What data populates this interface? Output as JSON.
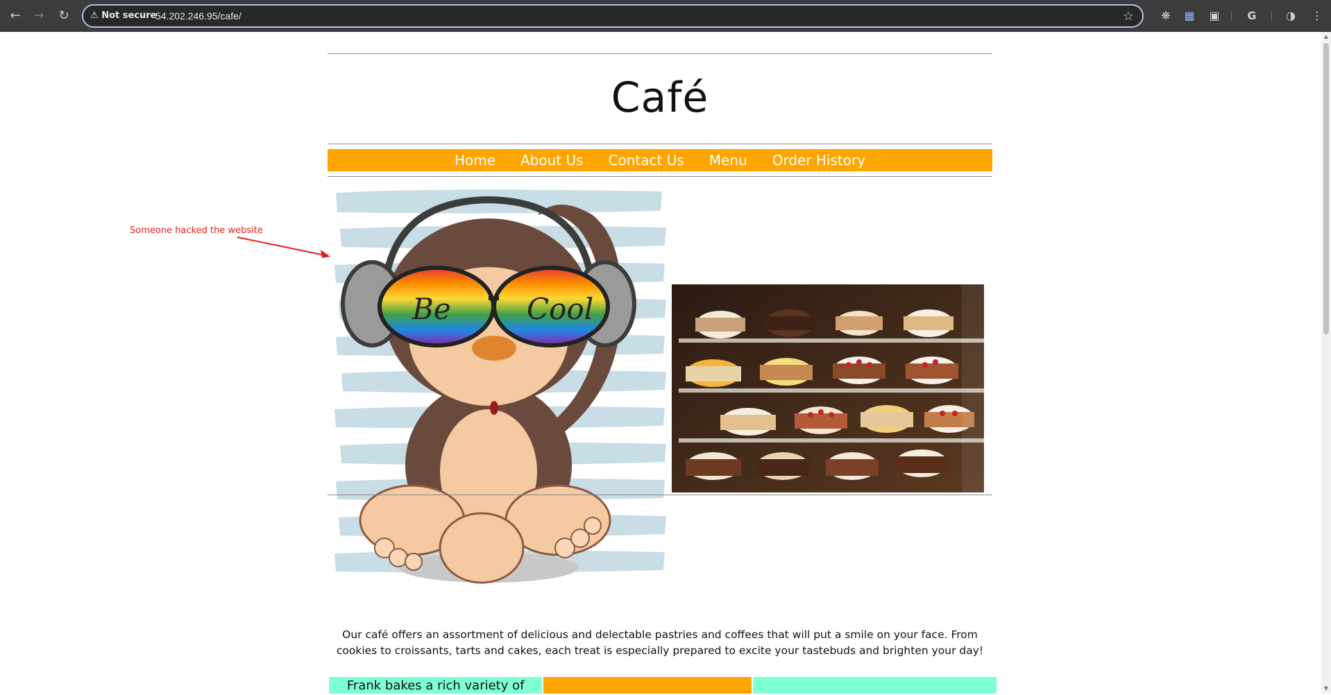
{
  "browser": {
    "security_label": "Not secure",
    "url": "54.202.246.95/cafe/",
    "back_icon": "arrow-left-icon",
    "forward_icon": "arrow-right-icon",
    "reload_icon": "reload-icon",
    "bookmark_icon": "star-icon"
  },
  "site": {
    "title": "Café"
  },
  "nav": {
    "items": [
      {
        "label": "Home"
      },
      {
        "label": "About Us"
      },
      {
        "label": "Contact Us"
      },
      {
        "label": "Menu"
      },
      {
        "label": "Order History"
      }
    ]
  },
  "annotation": {
    "text": "Someone hacked the website",
    "color": "#e0201c"
  },
  "images": {
    "monkey_text": "Be Cool",
    "monkey_icon": "monkey-illustration",
    "cake_icon": "cake-display-photo"
  },
  "intro": {
    "text": "Our café offers an assortment of delicious and delectable pastries and coffees that will put a smile on your face. From cookies to croissants, tarts and cakes, each treat is especially prepared to excite your tastebuds and brighten your day!"
  },
  "columns": {
    "col1_text": "Frank bakes a rich variety of"
  },
  "colors": {
    "nav_bg": "#ffa500",
    "accent_aqua": "#7fffd4"
  }
}
